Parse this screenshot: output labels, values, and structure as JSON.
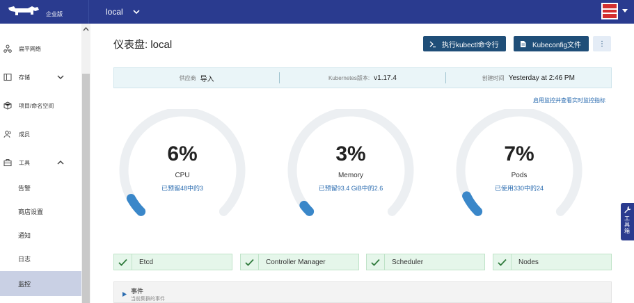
{
  "header": {
    "logo_text": "企业版",
    "cluster": "local"
  },
  "sidebar": {
    "items": [
      {
        "label": "扁平网络",
        "icon": "network-icon"
      },
      {
        "label": "存储",
        "icon": "storage-icon"
      },
      {
        "label": "项目/命名空间",
        "icon": "project-icon"
      },
      {
        "label": "成员",
        "icon": "members-icon"
      },
      {
        "label": "工具",
        "icon": "tools-icon"
      }
    ],
    "sub_items": [
      "告警",
      "商店设置",
      "通知",
      "日志",
      "监控"
    ],
    "active": "监控"
  },
  "main": {
    "title": "仪表盘: local",
    "kubectl_button": "执行kubectl命令行",
    "kubeconfig_button": "Kubeconfig文件",
    "more_button": "⋮",
    "info": {
      "provider_label": "供应商",
      "provider_value": "导入",
      "k8s_label": "Kubernetes版本:",
      "k8s_value": "v1.17.4",
      "created_label": "创建时间",
      "created_value": "Yesterday at 2:46 PM"
    },
    "monitor_link": "启用监控并查看实时监控指标",
    "gauges": [
      {
        "percent_label": "6%",
        "percent": 0.06,
        "name": "CPU",
        "detail": "已预留48中的3"
      },
      {
        "percent_label": "3%",
        "percent": 0.03,
        "name": "Memory",
        "detail": "已预留93.4 GiB中的2.6"
      },
      {
        "percent_label": "7%",
        "percent": 0.07,
        "name": "Pods",
        "detail": "已使用330中的24"
      }
    ],
    "components": [
      "Etcd",
      "Controller Manager",
      "Scheduler",
      "Nodes"
    ],
    "events_title": "事件",
    "events_subtitle": "当前集群的事件"
  },
  "tool_tab": "工具箱",
  "colors": {
    "brand": "#2a3b8f",
    "primary_button": "#1f4e78",
    "gauge_fill": "#3a87c9",
    "gauge_track": "#eceff2",
    "ok_bg": "#e5f6ea",
    "ok_check": "#2f7a3c"
  }
}
